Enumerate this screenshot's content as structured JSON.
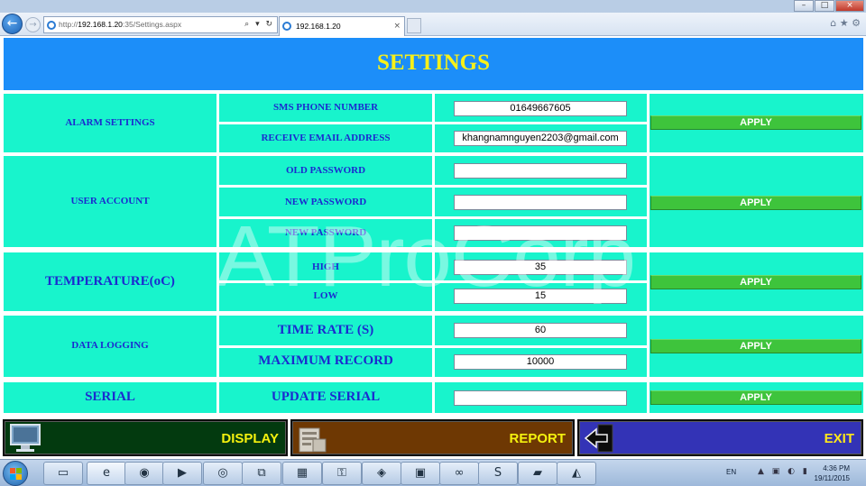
{
  "browser": {
    "url_prefix": "http://",
    "url_host": "192.168.1.20",
    "url_path": ":35/Settings.aspx",
    "tab_title": "192.168.1.20",
    "tab_close": "×",
    "back_glyph": "←",
    "forward_glyph": "→",
    "addr_tools": "⌕ ▾ ↻",
    "nav_right": "⌂ ★ ⚙",
    "win_min": "–",
    "win_max": "□",
    "win_close": "×"
  },
  "page": {
    "title": "SETTINGS",
    "watermark": "ATProCorp"
  },
  "alarm": {
    "category": "ALARM SETTINGS",
    "sms_label": "SMS PHONE NUMBER",
    "sms_value": "01649667605",
    "email_label": "RECEIVE EMAIL ADDRESS",
    "email_value": "khangnamnguyen2203@gmail.com",
    "apply": "APPLY"
  },
  "user_account": {
    "category": "USER ACCOUNT",
    "old_label": "OLD PASSWORD",
    "old_value": "",
    "new_label": "NEW PASSWORD",
    "new_value": "",
    "confirm_label": "NEW PASSWORD",
    "confirm_value": "",
    "apply": "APPLY"
  },
  "temperature": {
    "category": "TEMPERATURE(oC)",
    "high_label": "HIGH",
    "high_value": "35",
    "low_label": "LOW",
    "low_value": "15",
    "apply": "APPLY"
  },
  "data_logging": {
    "category": "DATA LOGGING",
    "rate_label": "TIME RATE (S)",
    "rate_value": "60",
    "max_label": "MAXIMUM RECORD",
    "max_value": "10000",
    "apply": "APPLY"
  },
  "serial": {
    "category": "SERIAL",
    "update_label": "UPDATE SERIAL",
    "update_value": "",
    "apply": "APPLY"
  },
  "nav": {
    "display": "DISPLAY",
    "report": "REPORT",
    "exit": "EXIT"
  },
  "taskbar": {
    "lang": "EN",
    "time": "4:36 PM",
    "date": "19/11/2015",
    "tray_icons": "▲ ▣ ◐ ▮"
  },
  "colors": {
    "banner": "#1c8ef9",
    "title_text": "#f7f01a",
    "panel": "#18f4cc",
    "label_text": "#1b2ad0",
    "apply_button": "#3ec43c",
    "display_button": "#033a0f",
    "report_button": "#6e3803",
    "exit_button": "#3333b6"
  }
}
